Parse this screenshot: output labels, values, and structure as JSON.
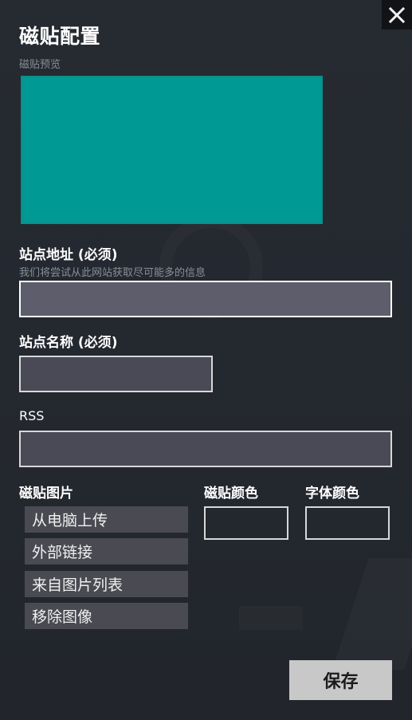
{
  "dialog": {
    "title": "磁贴配置",
    "close_icon": "close-icon"
  },
  "preview": {
    "label": "磁贴预览",
    "tile_color": "#009994"
  },
  "site_url": {
    "label": "站点地址 (必须)",
    "hint": "我们将尝试从此网站获取尽可能多的信息",
    "value": ""
  },
  "site_name": {
    "label": "站点名称 (必须)",
    "value": ""
  },
  "rss": {
    "label": "RSS",
    "value": ""
  },
  "tile_image": {
    "label": "磁贴图片",
    "buttons": [
      "从电脑上传",
      "外部链接",
      "来自图片列表",
      "移除图像"
    ]
  },
  "tile_color": {
    "label": "磁贴颜色"
  },
  "font_color": {
    "label": "字体颜色"
  },
  "save": {
    "label": "保存"
  }
}
